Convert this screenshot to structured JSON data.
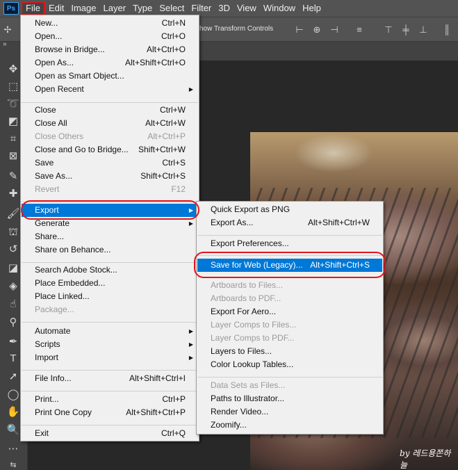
{
  "app": {
    "logo": "Ps"
  },
  "menubar": [
    "File",
    "Edit",
    "Image",
    "Layer",
    "Type",
    "Select",
    "Filter",
    "3D",
    "View",
    "Window",
    "Help"
  ],
  "options": {
    "transform_label": "how Transform Controls"
  },
  "toolbar_icons": [
    "move-icon",
    "marquee-icon",
    "lasso-icon",
    "quick-select-icon",
    "crop-icon",
    "frame-icon",
    "eyedropper-icon",
    "healing-icon",
    "brush-icon",
    "stamp-icon",
    "history-brush-icon",
    "eraser-icon",
    "paint-bucket-icon",
    "smudge-icon",
    "dodge-icon",
    "pen-icon",
    "type-icon",
    "path-select-icon",
    "ellipse-icon",
    "hand-icon",
    "zoom-icon",
    "more-icon",
    "swap-colors-icon"
  ],
  "file_menu": [
    {
      "label": "New...",
      "shortcut": "Ctrl+N",
      "disabled": false
    },
    {
      "label": "Open...",
      "shortcut": "Ctrl+O",
      "disabled": false
    },
    {
      "label": "Browse in Bridge...",
      "shortcut": "Alt+Ctrl+O",
      "disabled": false
    },
    {
      "label": "Open As...",
      "shortcut": "Alt+Shift+Ctrl+O",
      "disabled": false
    },
    {
      "label": "Open as Smart Object...",
      "shortcut": "",
      "disabled": false
    },
    {
      "label": "Open Recent",
      "shortcut": "",
      "submenu": true,
      "disabled": false
    },
    {
      "sep": true
    },
    {
      "label": "Close",
      "shortcut": "Ctrl+W",
      "disabled": false
    },
    {
      "label": "Close All",
      "shortcut": "Alt+Ctrl+W",
      "disabled": false
    },
    {
      "label": "Close Others",
      "shortcut": "Alt+Ctrl+P",
      "disabled": true
    },
    {
      "label": "Close and Go to Bridge...",
      "shortcut": "Shift+Ctrl+W",
      "disabled": false
    },
    {
      "label": "Save",
      "shortcut": "Ctrl+S",
      "disabled": false
    },
    {
      "label": "Save As...",
      "shortcut": "Shift+Ctrl+S",
      "disabled": false
    },
    {
      "label": "Revert",
      "shortcut": "F12",
      "disabled": true
    },
    {
      "sep": true
    },
    {
      "label": "Export",
      "shortcut": "",
      "submenu": true,
      "highlighted": true,
      "disabled": false
    },
    {
      "label": "Generate",
      "shortcut": "",
      "submenu": true,
      "disabled": false
    },
    {
      "label": "Share...",
      "shortcut": "",
      "disabled": false
    },
    {
      "label": "Share on Behance...",
      "shortcut": "",
      "disabled": false
    },
    {
      "sep": true
    },
    {
      "label": "Search Adobe Stock...",
      "shortcut": "",
      "disabled": false
    },
    {
      "label": "Place Embedded...",
      "shortcut": "",
      "disabled": false
    },
    {
      "label": "Place Linked...",
      "shortcut": "",
      "disabled": false
    },
    {
      "label": "Package...",
      "shortcut": "",
      "disabled": true
    },
    {
      "sep": true
    },
    {
      "label": "Automate",
      "shortcut": "",
      "submenu": true,
      "disabled": false
    },
    {
      "label": "Scripts",
      "shortcut": "",
      "submenu": true,
      "disabled": false
    },
    {
      "label": "Import",
      "shortcut": "",
      "submenu": true,
      "disabled": false
    },
    {
      "sep": true
    },
    {
      "label": "File Info...",
      "shortcut": "Alt+Shift+Ctrl+I",
      "disabled": false
    },
    {
      "sep": true
    },
    {
      "label": "Print...",
      "shortcut": "Ctrl+P",
      "disabled": false
    },
    {
      "label": "Print One Copy",
      "shortcut": "Alt+Shift+Ctrl+P",
      "disabled": false
    },
    {
      "sep": true
    },
    {
      "label": "Exit",
      "shortcut": "Ctrl+Q",
      "disabled": false
    }
  ],
  "export_menu": [
    {
      "label": "Quick Export as PNG",
      "shortcut": "",
      "disabled": false
    },
    {
      "label": "Export As...",
      "shortcut": "Alt+Shift+Ctrl+W",
      "disabled": false
    },
    {
      "sep": true
    },
    {
      "label": "Export Preferences...",
      "shortcut": "",
      "disabled": false
    },
    {
      "sep": true
    },
    {
      "label": "Save for Web (Legacy)...",
      "shortcut": "Alt+Shift+Ctrl+S",
      "highlighted": true,
      "disabled": false
    },
    {
      "sep": true
    },
    {
      "label": "Artboards to Files...",
      "shortcut": "",
      "disabled": true
    },
    {
      "label": "Artboards to PDF...",
      "shortcut": "",
      "disabled": true
    },
    {
      "label": "Export For Aero...",
      "shortcut": "",
      "disabled": false
    },
    {
      "label": "Layer Comps to Files...",
      "shortcut": "",
      "disabled": true
    },
    {
      "label": "Layer Comps to PDF...",
      "shortcut": "",
      "disabled": true
    },
    {
      "label": "Layers to Files...",
      "shortcut": "",
      "disabled": false
    },
    {
      "label": "Color Lookup Tables...",
      "shortcut": "",
      "disabled": false
    },
    {
      "sep": true
    },
    {
      "label": "Data Sets as Files...",
      "shortcut": "",
      "disabled": true
    },
    {
      "label": "Paths to Illustrator...",
      "shortcut": "",
      "disabled": false
    },
    {
      "label": "Render Video...",
      "shortcut": "",
      "disabled": false
    },
    {
      "label": "Zoomify...",
      "shortcut": "",
      "disabled": false
    }
  ],
  "watermark": "by 레드용쫀하늘",
  "colors": {
    "highlight": "#0078d7",
    "annotation": "#e1161e",
    "menu_bg": "#f0f0f0",
    "chrome": "#535353"
  }
}
